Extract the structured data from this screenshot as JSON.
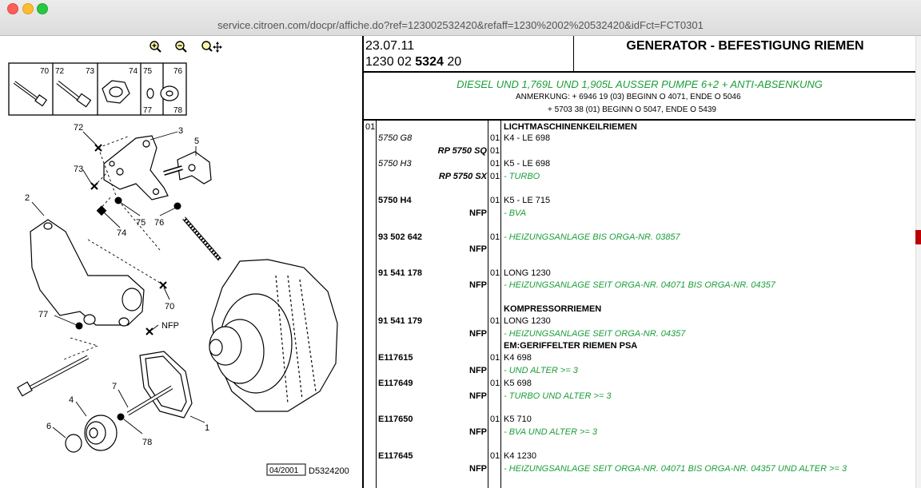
{
  "browser": {
    "url": "service.citroen.com/docpr/affiche.do?ref=123002532420&refaff=1230%2002%20532420&idFct=FCT0301"
  },
  "toolbar": {
    "zoom_in_icon": "zoom-in-icon",
    "zoom_out_icon": "zoom-out-icon",
    "zoom_move_icon": "zoom-move-icon"
  },
  "header": {
    "date": "23.07.11",
    "ref_prefix": "1230 02 ",
    "ref_bold": "5324",
    "ref_suffix": " 20",
    "title": "GENERATOR - BEFESTIGUNG RIEMEN"
  },
  "condition": {
    "title": "DIESEL UND 1,769L UND 1,905L AUSSER PUMPE 6+2 + ANTI-ABSENKUNG",
    "note1": "ANMERKUNG: + 6946 19 (03) BEGINN O 4071, ENDE O 5046",
    "note2": "+ 5703 38 (01) BEGINN O 5047, ENDE O 5439"
  },
  "diagram": {
    "hardware_labels": [
      "70",
      "72",
      "73",
      "74",
      "75",
      "76",
      "77",
      "78"
    ],
    "callouts": [
      "72",
      "3",
      "5",
      "73",
      "2",
      "75",
      "74",
      "76",
      "70",
      "77",
      "NFP",
      "7",
      "4",
      "6",
      "78",
      "1"
    ],
    "footer_date": "04/2001",
    "footer_ref": "D5324200"
  },
  "rows": [
    {
      "grp": "01",
      "ref": "",
      "sub": "",
      "qty": "",
      "desc": "LICHTMASCHINENKEILRIEMEN",
      "style": "head"
    },
    {
      "grp": "",
      "ref": "5750 G8",
      "sub": "",
      "qty": "01",
      "desc": "K4 - LE 698",
      "style": "it"
    },
    {
      "grp": "",
      "ref": "",
      "sub": "RP 5750 SQ",
      "qty": "01",
      "desc": "",
      "style": ""
    },
    {
      "grp": "",
      "ref": "5750 H3",
      "sub": "",
      "qty": "01",
      "desc": "K5 - LE 698",
      "style": "it"
    },
    {
      "grp": "",
      "ref": "",
      "sub": "RP 5750 SX",
      "qty": "01",
      "desc": "- TURBO",
      "style": "g"
    },
    {
      "grp": "",
      "ref": "5750 H4",
      "sub": "",
      "qty": "01",
      "desc": "K5 - LE 715",
      "style": "b"
    },
    {
      "grp": "",
      "ref": "",
      "sub": "NFP",
      "qty": "",
      "desc": "- BVA",
      "style": "g"
    },
    {
      "grp": "",
      "ref": "93 502 642",
      "sub": "",
      "qty": "01",
      "desc": "- HEIZUNGSANLAGE BIS ORGA-NR. 03857",
      "style": "bg"
    },
    {
      "grp": "",
      "ref": "",
      "sub": "NFP",
      "qty": "",
      "desc": "",
      "style": ""
    },
    {
      "grp": "",
      "ref": "91 541 178",
      "sub": "",
      "qty": "01",
      "desc": "LONG 1230",
      "style": "b"
    },
    {
      "grp": "",
      "ref": "",
      "sub": "NFP",
      "qty": "",
      "desc": "- HEIZUNGSANLAGE SEIT ORGA-NR. 04071 BIS ORGA-NR. 04357",
      "style": "g"
    },
    {
      "grp": "",
      "ref": "",
      "sub": "",
      "qty": "",
      "desc": "KOMPRESSORRIEMEN",
      "style": "head"
    },
    {
      "grp": "",
      "ref": "91 541 179",
      "sub": "",
      "qty": "01",
      "desc": "LONG 1230",
      "style": "b"
    },
    {
      "grp": "",
      "ref": "",
      "sub": "NFP",
      "qty": "",
      "desc": "- HEIZUNGSANLAGE SEIT ORGA-NR. 04357",
      "style": "g"
    },
    {
      "grp": "",
      "ref": "",
      "sub": "",
      "qty": "",
      "desc": "EM:GERIFFELTER RIEMEN PSA",
      "style": "head"
    },
    {
      "grp": "",
      "ref": "E117615",
      "sub": "",
      "qty": "01",
      "desc": "K4 698",
      "style": "b"
    },
    {
      "grp": "",
      "ref": "",
      "sub": "NFP",
      "qty": "",
      "desc": "- UND ALTER >= 3",
      "style": "g"
    },
    {
      "grp": "",
      "ref": "E117649",
      "sub": "",
      "qty": "01",
      "desc": "K5 698",
      "style": "b"
    },
    {
      "grp": "",
      "ref": "",
      "sub": "NFP",
      "qty": "",
      "desc": "- TURBO UND ALTER >= 3",
      "style": "g"
    },
    {
      "grp": "",
      "ref": "E117650",
      "sub": "",
      "qty": "01",
      "desc": "K5 710",
      "style": "b"
    },
    {
      "grp": "",
      "ref": "",
      "sub": "NFP",
      "qty": "",
      "desc": "- BVA UND ALTER >= 3",
      "style": "g"
    },
    {
      "grp": "",
      "ref": "E117645",
      "sub": "",
      "qty": "01",
      "desc": "K4 1230",
      "style": "b"
    },
    {
      "grp": "",
      "ref": "",
      "sub": "NFP",
      "qty": "",
      "desc": "- HEIZUNGSANLAGE SEIT ORGA-NR. 04071 BIS ORGA-NR. 04357 UND ALTER >= 3",
      "style": "g"
    }
  ],
  "colors": {
    "green_text": "#1a9e3a",
    "scroll_marker": "#bb0000"
  }
}
